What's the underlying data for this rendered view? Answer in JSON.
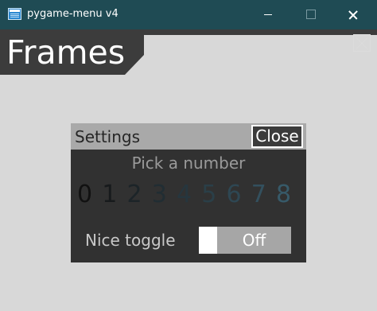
{
  "window": {
    "title": "pygame-menu v4",
    "icon": "pygame-app-icon",
    "controls": [
      "minimize-icon",
      "maximize-icon",
      "close-icon"
    ]
  },
  "menu": {
    "title": "Frames",
    "close_icon": "close-x-icon"
  },
  "frame": {
    "title": "Settings",
    "close_label": "Close",
    "pick_label": "Pick a number",
    "numbers": [
      {
        "label": "0",
        "color": "#111111"
      },
      {
        "label": "1",
        "color": "#171a1c"
      },
      {
        "label": "2",
        "color": "#1c2428"
      },
      {
        "label": "3",
        "color": "#212d33"
      },
      {
        "label": "4",
        "color": "#26363e"
      },
      {
        "label": "5",
        "color": "#2a3f48"
      },
      {
        "label": "6",
        "color": "#2e4753"
      },
      {
        "label": "7",
        "color": "#33505e"
      },
      {
        "label": "8",
        "color": "#375a69"
      }
    ],
    "toggle_label": "Nice toggle",
    "toggle_state": "Off"
  },
  "colors": {
    "titlebar": "#1f4b54",
    "background": "#d8d8d8",
    "header": "#3c3c3c",
    "frame_title_bar": "#a9a9a9",
    "frame_body": "#313131",
    "toggle_track": "#a6a6a6"
  }
}
